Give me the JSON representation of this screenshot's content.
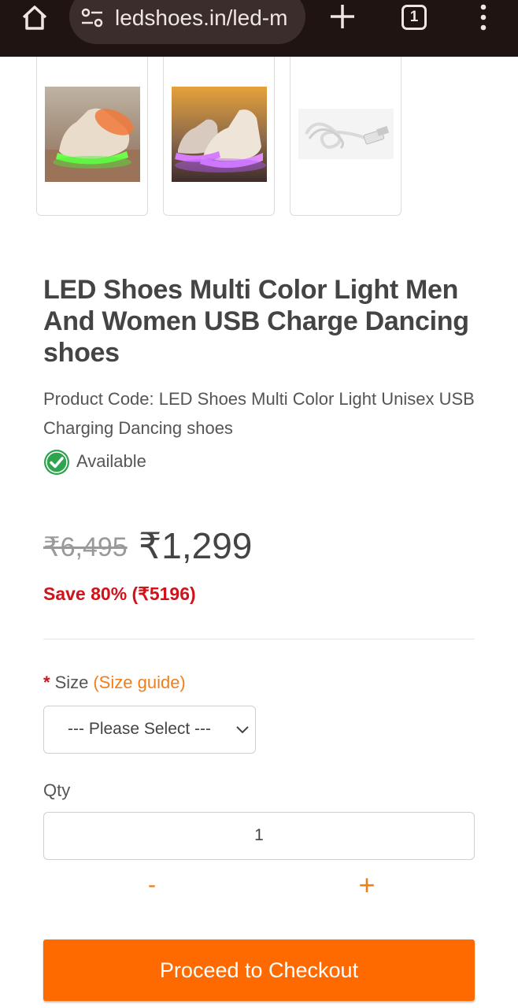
{
  "browser": {
    "url": "ledshoes.in/led-m",
    "tab_count": "1",
    "icons": [
      "home-icon",
      "site-settings-icon",
      "new-tab-icon",
      "tab-switcher-icon",
      "overflow-menu-icon"
    ]
  },
  "gallery": {
    "thumbnails": [
      {
        "alt": "white high-top shoe with green light"
      },
      {
        "alt": "white high-top shoe with purple light"
      },
      {
        "alt": "white USB charging cable"
      }
    ]
  },
  "product": {
    "title": "LED Shoes Multi Color Light Men And Women USB Charge Dancing shoes",
    "code": "Product Code: LED Shoes Multi Color Light Unisex USB Charging Dancing shoes",
    "availability": "Available",
    "old_price": "₹6,495",
    "new_price": "₹1,299",
    "save": "Save 80% (₹5196)"
  },
  "options": {
    "size_label": "Size",
    "size_required": "*",
    "size_guide": "(Size guide)",
    "size_selected": "--- Please Select ---",
    "qty_label": "Qty",
    "qty_value": "1",
    "minus": "-",
    "plus": "+"
  },
  "checkout_label": "Proceed to Checkout",
  "colors": {
    "accent": "#ff6a00",
    "link_orange": "#f07e1a",
    "sale_red": "#d0131a",
    "available_green": "#2ea44f",
    "chrome_bg": "#1f1412"
  }
}
